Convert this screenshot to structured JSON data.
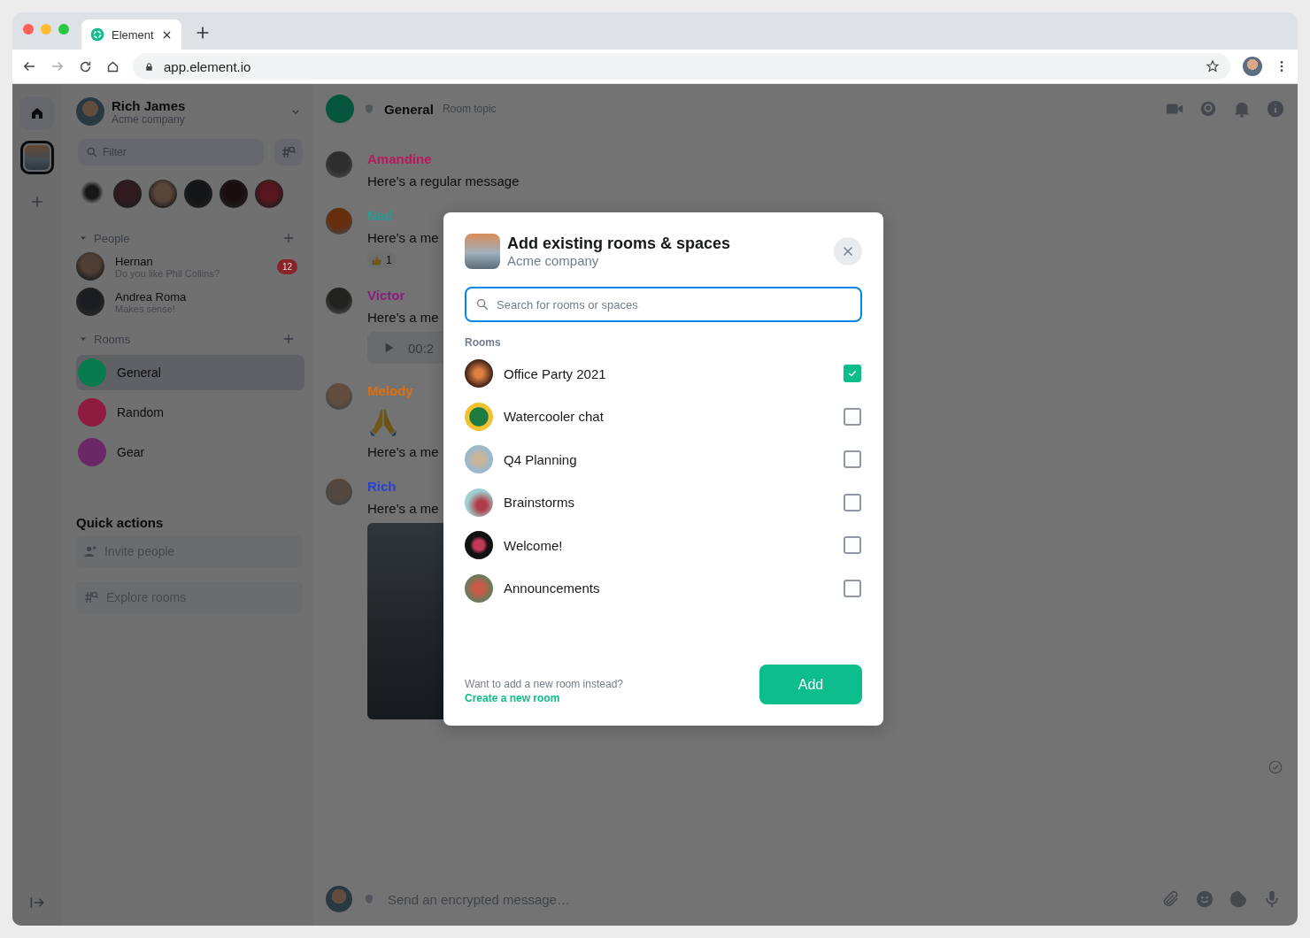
{
  "browser": {
    "tab_title": "Element",
    "url": "app.element.io"
  },
  "spaces": [
    {
      "kind": "home",
      "selected": false
    },
    {
      "kind": "space",
      "selected": true
    },
    {
      "kind": "create",
      "selected": false
    }
  ],
  "room_list": {
    "user": {
      "name": "Rich James",
      "subtitle": "Acme company"
    },
    "filter": {
      "placeholder": "Filter"
    },
    "sections": [
      {
        "kind": "people",
        "title": "People",
        "expanded": true,
        "items": [
          {
            "name": "Hernan",
            "preview": "Do you like Phil Collins?",
            "badge": "12"
          },
          {
            "name": "Andrea Roma",
            "preview": "Makes sense!"
          }
        ]
      },
      {
        "kind": "rooms",
        "title": "Rooms",
        "expanded": true,
        "items": [
          {
            "name": "General",
            "color": "#077a4e",
            "selected": true
          },
          {
            "name": "Random",
            "color": "#8f1c40",
            "selected": false
          },
          {
            "name": "Gear",
            "color": "#6a2868",
            "selected": false
          }
        ]
      }
    ],
    "quick_actions": {
      "title": "Quick actions",
      "items": [
        {
          "kind": "invite",
          "label": "Invite people"
        },
        {
          "kind": "explore",
          "label": "Explore rooms"
        }
      ]
    }
  },
  "timeline": {
    "header": {
      "name": "General",
      "topic": "Room topic"
    },
    "messages": [
      {
        "sender": "Amandine",
        "color": "#b8185e",
        "parts": [
          {
            "kind": "text",
            "text": "Here’s a regular message"
          }
        ]
      },
      {
        "sender": "Nad",
        "color": "#2a9a90",
        "parts": [
          {
            "kind": "text",
            "text": "Here’s a me"
          },
          {
            "kind": "reaction",
            "count": "1"
          }
        ]
      },
      {
        "sender": "Victor",
        "color": "#8a1a80",
        "parts": [
          {
            "kind": "text",
            "text": "Here’s a me"
          },
          {
            "kind": "voice",
            "duration": "00:2"
          }
        ]
      },
      {
        "sender": "Melody",
        "color": "#e0700a",
        "parts": [
          {
            "kind": "emoji"
          },
          {
            "kind": "text",
            "text": "Here’s a me"
          }
        ]
      },
      {
        "sender": "Rich",
        "color": "#2a40d0",
        "parts": [
          {
            "kind": "text",
            "text": "Here’s a me"
          },
          {
            "kind": "image"
          }
        ]
      }
    ],
    "composer": {
      "placeholder": "Send an encrypted message…"
    }
  },
  "dialog": {
    "title": "Add existing rooms & spaces",
    "subtitle": "Acme company",
    "search": {
      "placeholder": "Search for rooms or spaces"
    },
    "section_title": "Rooms",
    "rooms": [
      {
        "name": "Office Party 2021",
        "checked": true
      },
      {
        "name": "Watercooler chat",
        "checked": false
      },
      {
        "name": "Q4 Planning",
        "checked": false
      },
      {
        "name": "Brainstorms",
        "checked": false
      },
      {
        "name": "Welcome!",
        "checked": false
      },
      {
        "name": "Announcements",
        "checked": false
      }
    ],
    "footer": {
      "text": "Want to add a new room instead?",
      "link": "Create a new room"
    },
    "button": "Add"
  }
}
